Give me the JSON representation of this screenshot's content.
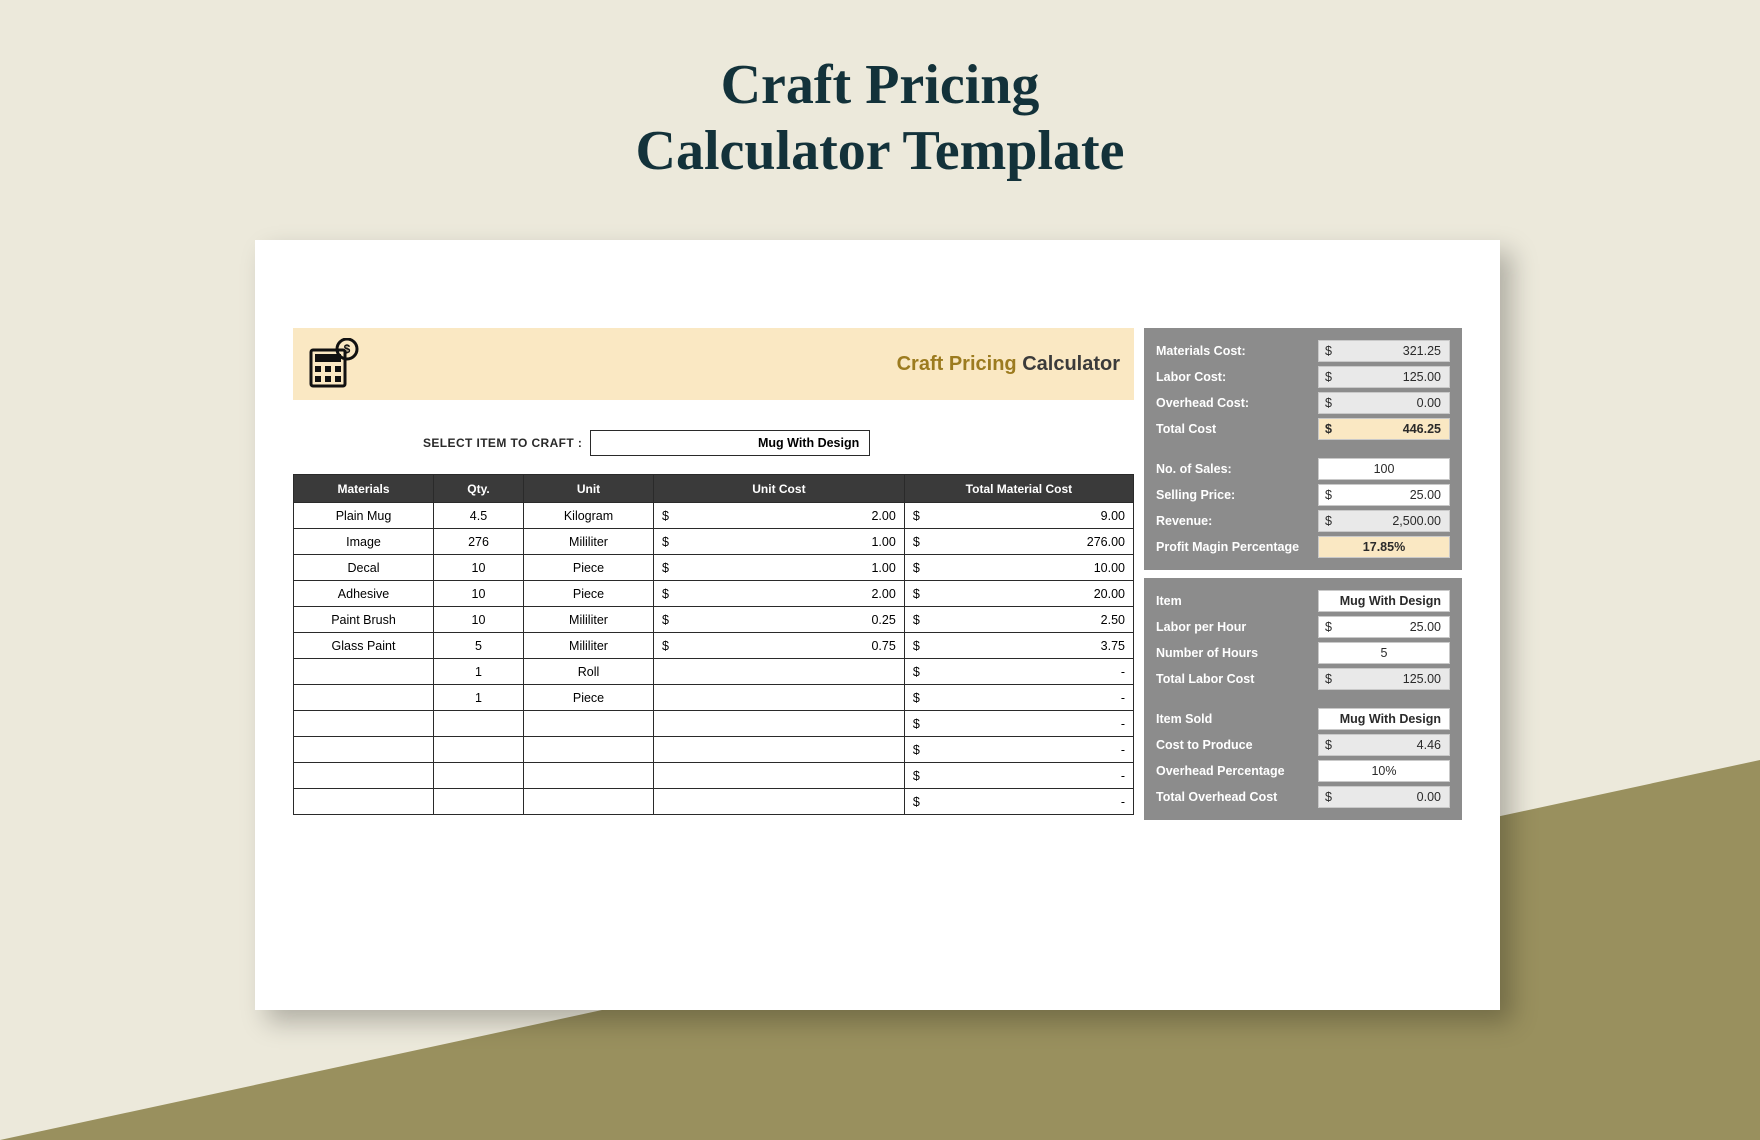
{
  "title_line1": "Craft Pricing",
  "title_line2": "Calculator Template",
  "header": {
    "accent": "Craft Pricing",
    "rest": " Calculator"
  },
  "select": {
    "label": "SELECT ITEM TO CRAFT   :",
    "value": "Mug With Design"
  },
  "table": {
    "headers": [
      "Materials",
      "Qty.",
      "Unit",
      "Unit Cost",
      "Total Material Cost"
    ],
    "rows": [
      {
        "material": "Plain Mug",
        "qty": "4.5",
        "unit": "Kilogram",
        "unit_cost": "2.00",
        "total": "9.00"
      },
      {
        "material": "Image",
        "qty": "276",
        "unit": "Mililiter",
        "unit_cost": "1.00",
        "total": "276.00"
      },
      {
        "material": "Decal",
        "qty": "10",
        "unit": "Piece",
        "unit_cost": "1.00",
        "total": "10.00"
      },
      {
        "material": "Adhesive",
        "qty": "10",
        "unit": "Piece",
        "unit_cost": "2.00",
        "total": "20.00"
      },
      {
        "material": "Paint Brush",
        "qty": "10",
        "unit": "Mililiter",
        "unit_cost": "0.25",
        "total": "2.50"
      },
      {
        "material": "Glass Paint",
        "qty": "5",
        "unit": "Mililiter",
        "unit_cost": "0.75",
        "total": "3.75"
      },
      {
        "material": "",
        "qty": "1",
        "unit": "Roll",
        "unit_cost": "",
        "total": "-"
      },
      {
        "material": "",
        "qty": "1",
        "unit": "Piece",
        "unit_cost": "",
        "total": "-"
      },
      {
        "material": "",
        "qty": "",
        "unit": "",
        "unit_cost": "",
        "total": "-"
      },
      {
        "material": "",
        "qty": "",
        "unit": "",
        "unit_cost": "",
        "total": "-"
      },
      {
        "material": "",
        "qty": "",
        "unit": "",
        "unit_cost": "",
        "total": "-"
      },
      {
        "material": "",
        "qty": "",
        "unit": "",
        "unit_cost": "",
        "total": "-"
      }
    ]
  },
  "summary": {
    "materials_cost_label": "Materials Cost:",
    "materials_cost": "321.25",
    "labor_cost_label": "Labor Cost:",
    "labor_cost": "125.00",
    "overhead_cost_label": "Overhead Cost:",
    "overhead_cost": "0.00",
    "total_cost_label": "Total Cost",
    "total_cost": "446.25",
    "no_sales_label": "No. of Sales:",
    "no_sales": "100",
    "selling_price_label": "Selling Price:",
    "selling_price": "25.00",
    "revenue_label": "Revenue:",
    "revenue": "2,500.00",
    "profit_margin_label": "Profit Magin Percentage",
    "profit_margin": "17.85%"
  },
  "labor": {
    "item_label": "Item",
    "item": "Mug With Design",
    "labor_per_hour_label": "Labor per Hour",
    "labor_per_hour": "25.00",
    "hours_label": "Number of Hours",
    "hours": "5",
    "total_labor_label": "Total Labor Cost",
    "total_labor": "125.00"
  },
  "overhead": {
    "item_sold_label": "Item Sold",
    "item_sold": "Mug With Design",
    "cost_produce_label": "Cost to Produce",
    "cost_produce": "4.46",
    "overhead_pct_label": "Overhead Percentage",
    "overhead_pct": "10%",
    "total_overhead_label": "Total Overhead Cost",
    "total_overhead": "0.00"
  },
  "currency": "$"
}
